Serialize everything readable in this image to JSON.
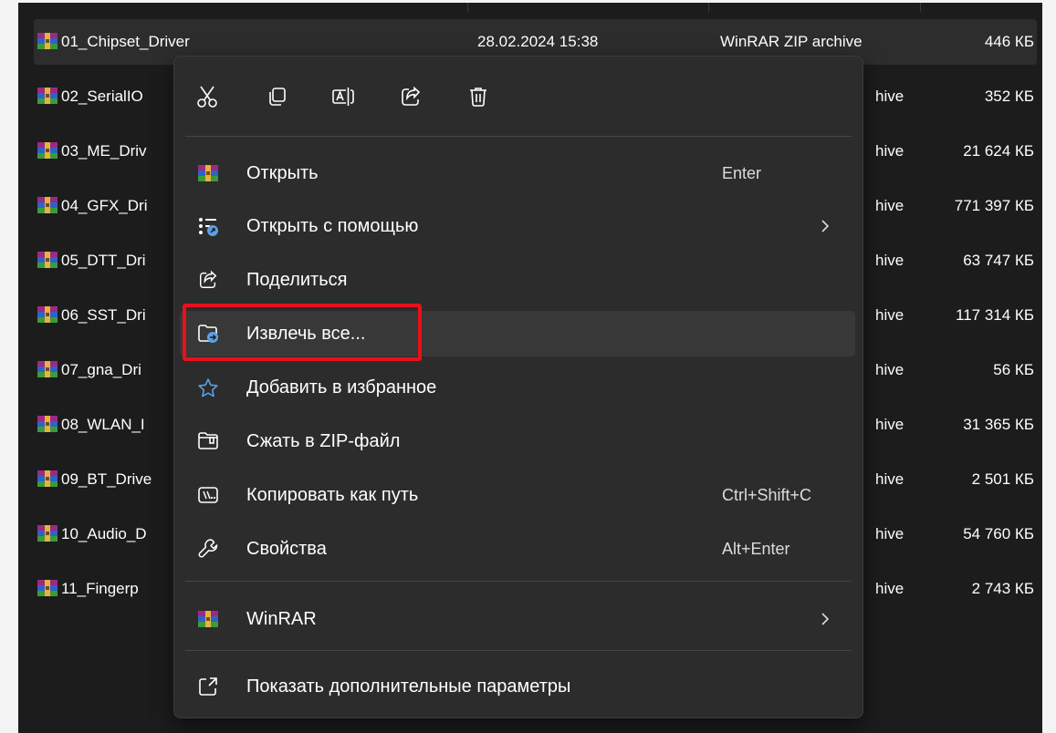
{
  "files": [
    {
      "name": "01_Chipset_Driver",
      "date": "28.02.2024 15:38",
      "type": "WinRAR ZIP archive",
      "size": "446 КБ"
    },
    {
      "name": "02_SerialIO",
      "date": "",
      "type": "hive",
      "size": "352 КБ"
    },
    {
      "name": "03_ME_Driv",
      "date": "",
      "type": "hive",
      "size": "21 624 КБ"
    },
    {
      "name": "04_GFX_Dri",
      "date": "",
      "type": "hive",
      "size": "771 397 КБ"
    },
    {
      "name": "05_DTT_Dri",
      "date": "",
      "type": "hive",
      "size": "63 747 КБ"
    },
    {
      "name": "06_SST_Dri",
      "date": "",
      "type": "hive",
      "size": "117 314 КБ"
    },
    {
      "name": "07_gna_Dri",
      "date": "",
      "type": "hive",
      "size": "56 КБ"
    },
    {
      "name": "08_WLAN_I",
      "date": "",
      "type": "hive",
      "size": "31 365 КБ"
    },
    {
      "name": "09_BT_Drive",
      "date": "",
      "type": "hive",
      "size": "2 501 КБ"
    },
    {
      "name": "10_Audio_D",
      "date": "",
      "type": "hive",
      "size": "54 760 КБ"
    },
    {
      "name": "11_Fingerp",
      "date": "",
      "type": "hive",
      "size": "2 743 КБ"
    }
  ],
  "toolbar": {
    "icons": [
      "cut-icon",
      "copy-icon",
      "rename-icon",
      "share-icon",
      "delete-icon"
    ]
  },
  "menu": {
    "items": [
      {
        "label": "Открыть",
        "shortcut": "Enter",
        "icon": "winrar-icon"
      },
      {
        "label": "Открыть с помощью",
        "shortcut": "",
        "icon": "open-with-icon",
        "submenu": true
      },
      {
        "label": "Поделиться",
        "shortcut": "",
        "icon": "share-icon"
      },
      {
        "label": "Извлечь все...",
        "shortcut": "",
        "icon": "extract-folder-icon",
        "hovered": true
      },
      {
        "label": "Добавить в избранное",
        "shortcut": "",
        "icon": "star-icon"
      },
      {
        "label": "Сжать в ZIP-файл",
        "shortcut": "",
        "icon": "zip-folder-icon"
      },
      {
        "label": "Копировать как путь",
        "shortcut": "Ctrl+Shift+C",
        "icon": "copy-path-icon"
      },
      {
        "label": "Свойства",
        "shortcut": "Alt+Enter",
        "icon": "wrench-icon"
      },
      {
        "label": "WinRAR",
        "shortcut": "",
        "icon": "winrar-icon",
        "submenu": true
      },
      {
        "label": "Показать дополнительные параметры",
        "shortcut": "",
        "icon": "more-options-icon"
      }
    ]
  },
  "colors": {
    "background": "#1c1c1c",
    "menu_background": "#2c2c2c",
    "highlight": "#e8101a",
    "text": "#ffffff"
  }
}
